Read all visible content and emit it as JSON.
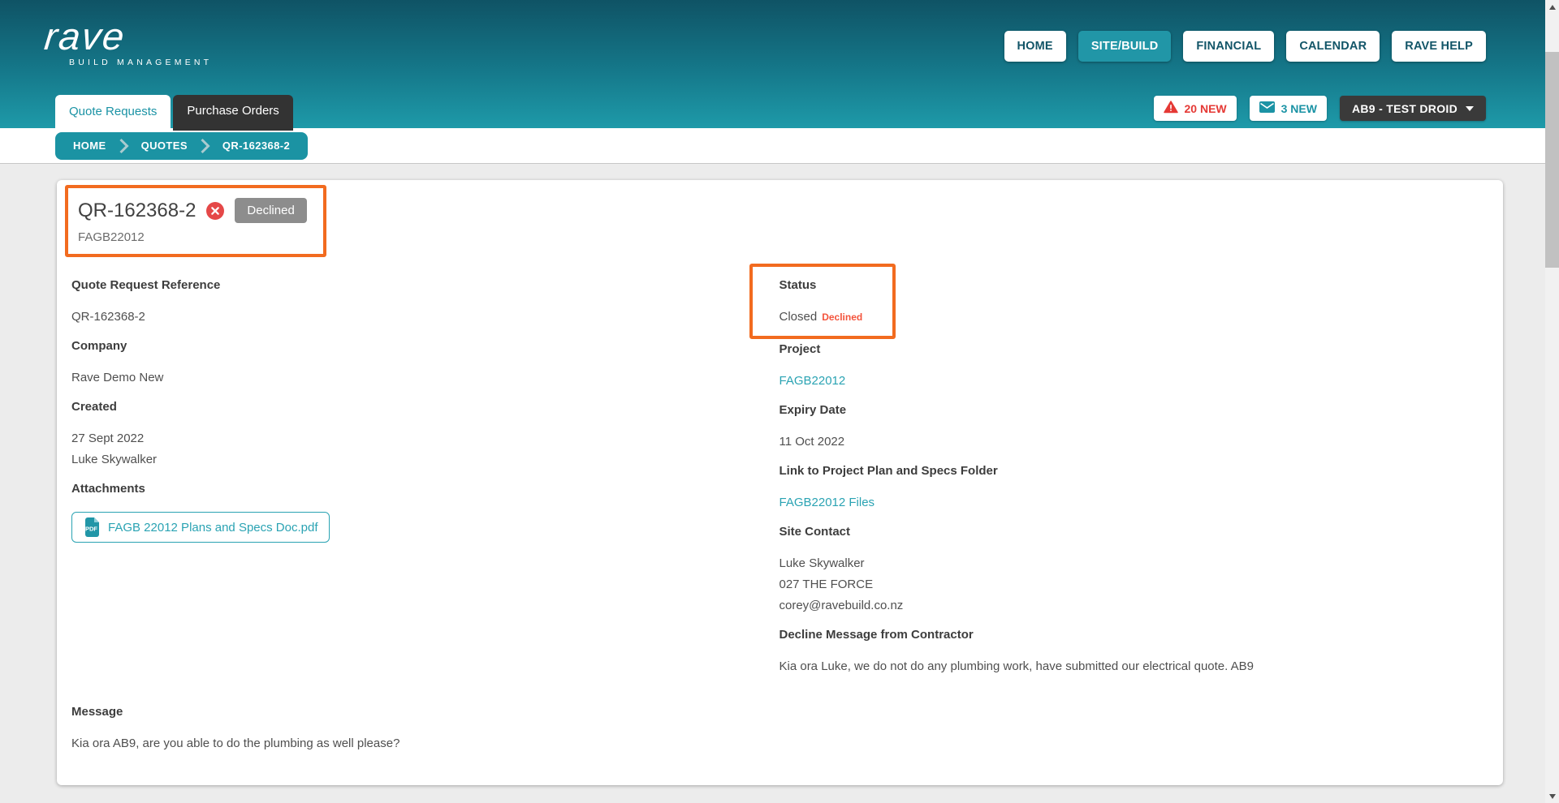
{
  "palette": {
    "accent_teal": "#1b95a5",
    "link_teal": "#2aa3b3",
    "annotation_orange": "#f26b1f",
    "alert_red": "#e53935",
    "declined_text_red": "#f4543c",
    "badge_gray": "#8d8d8d",
    "dark_menu": "#3a3a3a"
  },
  "header": {
    "brand": "rave",
    "tagline": "BUILD MANAGEMENT",
    "nav": [
      {
        "label": "HOME",
        "active": false
      },
      {
        "label": "SITE/BUILD",
        "active": true
      },
      {
        "label": "FINANCIAL",
        "active": false
      },
      {
        "label": "CALENDAR",
        "active": false
      },
      {
        "label": "RAVE HELP",
        "active": false
      }
    ],
    "tabs": [
      {
        "label": "Quote Requests",
        "active": true
      },
      {
        "label": "Purchase Orders",
        "active": false
      }
    ],
    "badges": {
      "warning": "20 NEW",
      "mail": "3 NEW",
      "user_menu": "AB9 - TEST DROID"
    }
  },
  "breadcrumb": {
    "items": [
      "HOME",
      "QUOTES",
      "QR-162368-2"
    ]
  },
  "quote": {
    "title": "QR-162368-2",
    "status_badge": "Declined",
    "subtitle": "FAGB22012",
    "reference": {
      "label": "Quote Request Reference",
      "value": "QR-162368-2"
    },
    "company": {
      "label": "Company",
      "value": "Rave Demo New"
    },
    "created": {
      "label": "Created",
      "date": "27 Sept 2022",
      "by": "Luke Skywalker"
    },
    "attachments": {
      "label": "Attachments",
      "file": "FAGB 22012 Plans and Specs Doc.pdf"
    },
    "status": {
      "label": "Status",
      "value": "Closed",
      "detail": "Declined"
    },
    "project": {
      "label": "Project",
      "link": "FAGB22012"
    },
    "expiry": {
      "label": "Expiry Date",
      "value": "11 Oct 2022"
    },
    "plans_folder": {
      "label": "Link to Project Plan and Specs Folder",
      "link": "FAGB22012 Files"
    },
    "site_contact": {
      "label": "Site Contact",
      "name": "Luke Skywalker",
      "phone": "027 THE FORCE",
      "email": "corey@ravebuild.co.nz"
    },
    "decline_message": {
      "label": "Decline Message from Contractor",
      "text": "Kia ora Luke, we do not do any plumbing work, have submitted our electrical quote. AB9"
    },
    "message": {
      "label": "Message",
      "text": "Kia ora AB9, are you able to do the plumbing as well please?"
    }
  }
}
